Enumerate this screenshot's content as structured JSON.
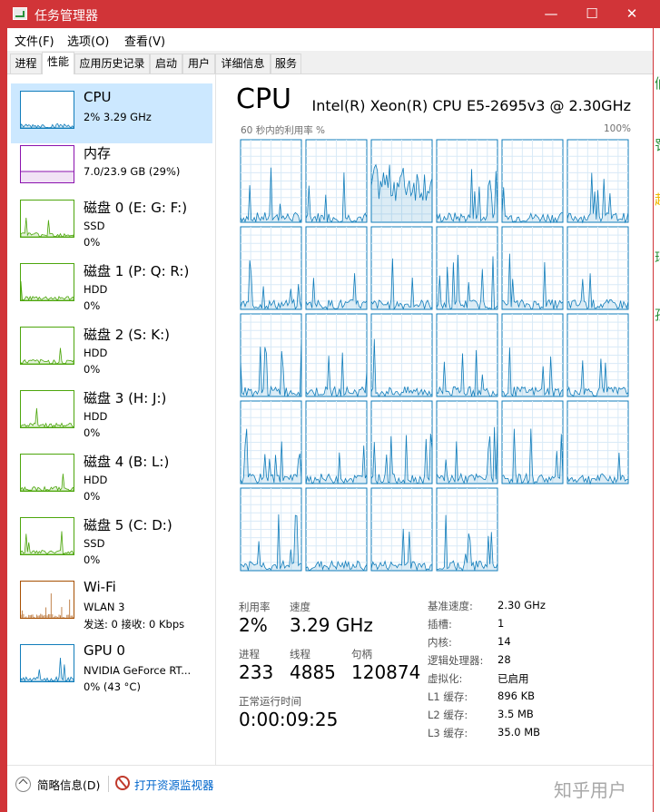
{
  "window": {
    "title": "任务管理器",
    "min_glyph": "—",
    "max_glyph": "☐",
    "close_glyph": "✕"
  },
  "menu": [
    "文件(F)",
    "选项(O)",
    "查看(V)"
  ],
  "tabs": [
    "进程",
    "性能",
    "应用历史记录",
    "启动",
    "用户",
    "详细信息",
    "服务"
  ],
  "active_tab": "性能",
  "sidebar": [
    {
      "title": "CPU",
      "sub": "2% 3.29 GHz",
      "sub2": "",
      "color": "#117dbb"
    },
    {
      "title": "内存",
      "sub": "7.0/23.9 GB (29%)",
      "sub2": "",
      "color": "#8b12ae"
    },
    {
      "title": "磁盘 0 (E: G: F:)",
      "sub": "SSD",
      "sub2": "0%",
      "color": "#4da60c"
    },
    {
      "title": "磁盘 1 (P: Q: R:)",
      "sub": "HDD",
      "sub2": "0%",
      "color": "#4da60c"
    },
    {
      "title": "磁盘 2 (S: K:)",
      "sub": "HDD",
      "sub2": "0%",
      "color": "#4da60c"
    },
    {
      "title": "磁盘 3 (H: J:)",
      "sub": "HDD",
      "sub2": "0%",
      "color": "#4da60c"
    },
    {
      "title": "磁盘 4 (B: L:)",
      "sub": "HDD",
      "sub2": "0%",
      "color": "#4da60c"
    },
    {
      "title": "磁盘 5 (C: D:)",
      "sub": "SSD",
      "sub2": "0%",
      "color": "#4da60c"
    },
    {
      "title": "Wi-Fi",
      "sub": "WLAN 3",
      "sub2": "发送: 0 接收: 0 Kbps",
      "color": "#a74f01"
    },
    {
      "title": "GPU 0",
      "sub": "NVIDIA GeForce RT...",
      "sub2": "0% (43 °C)",
      "color": "#117dbb"
    }
  ],
  "cpu": {
    "heading": "CPU",
    "model": "Intel(R) Xeon(R) CPU E5-2695v3 @ 2.30GHz",
    "axis_left": "60 秒内的利用率 %",
    "axis_right": "100%",
    "logical_processor_graphs": 28,
    "graph_color": "#117dbb"
  },
  "stats": {
    "util_label": "利用率",
    "util": "2%",
    "speed_label": "速度",
    "speed": "3.29 GHz",
    "proc_label": "进程",
    "proc": "233",
    "threads_label": "线程",
    "threads": "4885",
    "handles_label": "句柄",
    "handles": "120874",
    "uptime_label": "正常运行时间",
    "uptime": "0:00:09:25"
  },
  "info": [
    {
      "label": "基准速度:",
      "value": "2.30 GHz"
    },
    {
      "label": "插槽:",
      "value": "1"
    },
    {
      "label": "内核:",
      "value": "14"
    },
    {
      "label": "逻辑处理器:",
      "value": "28"
    },
    {
      "label": "虚拟化:",
      "value": "已启用"
    },
    {
      "label": "L1 缓存:",
      "value": "896 KB"
    },
    {
      "label": "L2 缓存:",
      "value": "3.5 MB"
    },
    {
      "label": "L3 缓存:",
      "value": "35.0 MB"
    }
  ],
  "footer": {
    "fewer": "简略信息(D)",
    "open_rm": "打开资源监视器"
  },
  "watermark": "知乎用户",
  "edge_glyphs": [
    "们",
    "罚",
    "起",
    "环",
    "孩"
  ]
}
